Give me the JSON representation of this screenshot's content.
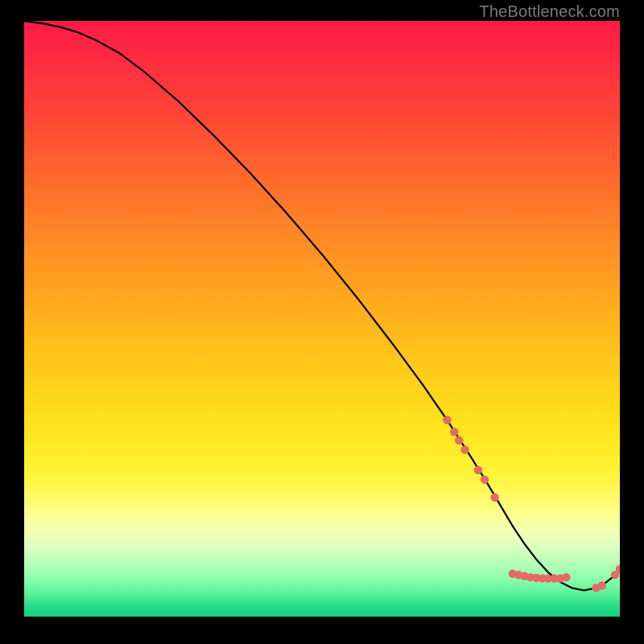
{
  "watermark": "TheBottleneck.com",
  "colors": {
    "marker": "#e46a63",
    "curve": "#000000",
    "bg": "#000000"
  },
  "chart_data": {
    "type": "line",
    "title": "",
    "xlabel": "",
    "ylabel": "",
    "xlim": [
      0,
      100
    ],
    "ylim": [
      0,
      100
    ],
    "curve": {
      "x": [
        0,
        3,
        6,
        9,
        12,
        16,
        20,
        26,
        32,
        38,
        44,
        50,
        56,
        62,
        67,
        71,
        74.5,
        77.5,
        80,
        82,
        84,
        86,
        88,
        90,
        92,
        94,
        96,
        97.5,
        99,
        100
      ],
      "y": [
        100,
        99.6,
        99.0,
        98.1,
        96.8,
        94.6,
        91.6,
        86.4,
        80.6,
        74.4,
        67.8,
        60.8,
        53.4,
        45.6,
        38.8,
        33.0,
        27.6,
        22.8,
        18.6,
        15.2,
        12.2,
        9.6,
        7.4,
        5.8,
        4.8,
        4.4,
        4.8,
        5.6,
        6.8,
        8.0
      ]
    },
    "markers": [
      {
        "x": 71.0,
        "y": 33.0
      },
      {
        "x": 72.2,
        "y": 31.0
      },
      {
        "x": 73.0,
        "y": 29.6
      },
      {
        "x": 74.0,
        "y": 28.0
      },
      {
        "x": 76.2,
        "y": 24.6
      },
      {
        "x": 77.3,
        "y": 23.0
      },
      {
        "x": 79.0,
        "y": 20.0
      },
      {
        "x": 82.0,
        "y": 7.2
      },
      {
        "x": 83.0,
        "y": 7.0
      },
      {
        "x": 84.0,
        "y": 6.8
      },
      {
        "x": 85.0,
        "y": 6.6
      },
      {
        "x": 86.0,
        "y": 6.5
      },
      {
        "x": 87.0,
        "y": 6.4
      },
      {
        "x": 88.0,
        "y": 6.4
      },
      {
        "x": 89.0,
        "y": 6.4
      },
      {
        "x": 90.0,
        "y": 6.4
      },
      {
        "x": 91.0,
        "y": 6.6
      },
      {
        "x": 96.0,
        "y": 4.8
      },
      {
        "x": 97.0,
        "y": 5.2
      },
      {
        "x": 99.2,
        "y": 7.0
      },
      {
        "x": 100.0,
        "y": 8.0
      }
    ]
  }
}
